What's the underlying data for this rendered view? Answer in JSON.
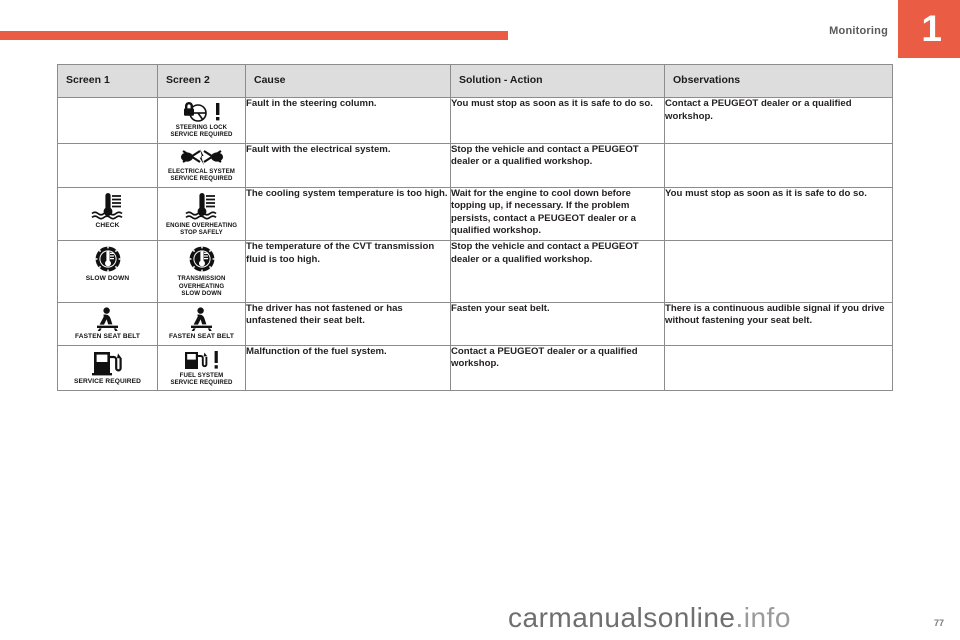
{
  "header": {
    "chapter_number": "1",
    "section_title": "Monitoring",
    "accent_color": "#eb5c45"
  },
  "table": {
    "columns": [
      {
        "label": "Screen 1"
      },
      {
        "label": "Screen 2"
      },
      {
        "label": "Cause"
      },
      {
        "label": "Solution - Action"
      },
      {
        "label": "Observations"
      }
    ],
    "rows": [
      {
        "screen1": null,
        "screen2": {
          "icon": "steering-lock-icon",
          "caption": "STEERING LOCK\nSERVICE REQUIRED"
        },
        "cause": "Fault in the steering column.",
        "solution": "You must stop as soon as it is safe to do so.",
        "observations": "Contact a PEUGEOT dealer or a qualified workshop."
      },
      {
        "screen1": null,
        "screen2": {
          "icon": "electrical-system-icon",
          "caption": "ELECTRICAL SYSTEM\nSERVICE REQUIRED"
        },
        "cause": "Fault with the electrical system.",
        "solution": "Stop the vehicle and contact a PEUGEOT dealer or a qualified workshop.",
        "observations": ""
      },
      {
        "screen1": {
          "icon": "coolant-temperature-icon",
          "caption": "CHECK"
        },
        "screen2": {
          "icon": "coolant-temperature-icon",
          "caption": "ENGINE OVERHEATING\nSTOP SAFELY"
        },
        "cause": "The cooling system temperature is too high.",
        "solution": "Wait for the engine to cool down before topping up, if necessary. If the problem persists, contact a PEUGEOT dealer or a qualified workshop.",
        "observations": "You must stop as soon as it is safe to do so."
      },
      {
        "screen1": {
          "icon": "transmission-overheating-icon",
          "caption": "SLOW DOWN"
        },
        "screen2": {
          "icon": "transmission-overheating-icon",
          "caption": "TRANSMISSION\nOVERHEATING\nSLOW DOWN"
        },
        "cause": "The temperature of the CVT transmission fluid is too high.",
        "solution": "Stop the vehicle and contact a PEUGEOT dealer or a qualified workshop.",
        "observations": ""
      },
      {
        "screen1": {
          "icon": "seat-belt-icon",
          "caption": "FASTEN SEAT BELT"
        },
        "screen2": {
          "icon": "seat-belt-icon",
          "caption": "FASTEN SEAT BELT"
        },
        "cause": "The driver has not fastened or has unfastened their seat belt.",
        "solution": "Fasten your seat belt.",
        "observations": "There is a continuous audible signal if you drive without fastening your seat belt."
      },
      {
        "screen1": {
          "icon": "fuel-pump-icon",
          "caption": "SERVICE REQUIRED"
        },
        "screen2": {
          "icon": "fuel-system-icon",
          "caption": "FUEL SYSTEM\nSERVICE REQUIRED"
        },
        "cause": "Malfunction of the fuel system.",
        "solution": "Contact a PEUGEOT dealer or a qualified workshop.",
        "observations": ""
      }
    ]
  },
  "footer": {
    "watermark": "carmanualsonline.info",
    "page_number": "77"
  }
}
